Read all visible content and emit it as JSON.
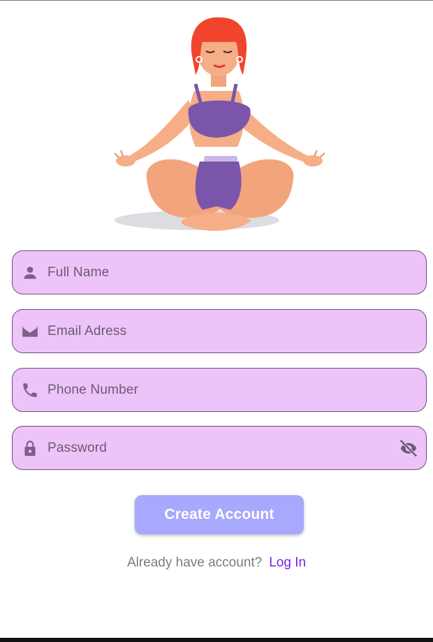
{
  "form": {
    "fields": [
      {
        "placeholder": "Full Name",
        "icon": "person-icon"
      },
      {
        "placeholder": "Email Adress",
        "icon": "mail-icon"
      },
      {
        "placeholder": "Phone Number",
        "icon": "phone-icon"
      },
      {
        "placeholder": "Password",
        "icon": "lock-icon",
        "trailing_icon": "visibility-off-icon"
      }
    ],
    "submit_label": "Create Account"
  },
  "footer": {
    "question": "Already have account?",
    "login_label": "Log In"
  },
  "colors": {
    "field_fill": "#ecc4f9",
    "field_border": "#6e4c76",
    "button": "#a8a8fd",
    "link": "#7a1fe0"
  }
}
